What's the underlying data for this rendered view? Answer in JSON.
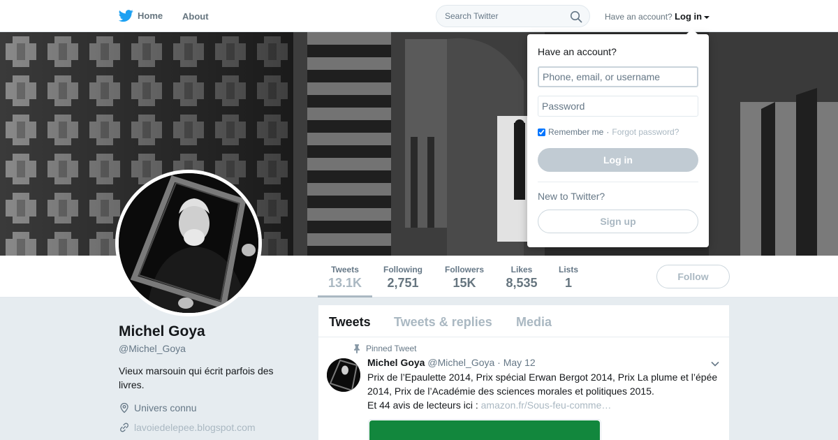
{
  "nav": {
    "home_label": "Home",
    "about_label": "About",
    "search_placeholder": "Search Twitter",
    "account_prefix": "Have an account?",
    "login_label": "Log in"
  },
  "profile": {
    "name": "Michel Goya",
    "handle": "@Michel_Goya",
    "bio": "Vieux marsouin qui écrit parfois des livres.",
    "location": "Univers connu",
    "url": "lavoiedelepee.blogspot.com"
  },
  "stats": [
    {
      "label": "Tweets",
      "value": "13.1K"
    },
    {
      "label": "Following",
      "value": "2,751"
    },
    {
      "label": "Followers",
      "value": "15K"
    },
    {
      "label": "Likes",
      "value": "8,535"
    },
    {
      "label": "Lists",
      "value": "1"
    }
  ],
  "follow_label": "Follow",
  "timeline": {
    "tabs": [
      "Tweets",
      "Tweets & replies",
      "Media"
    ],
    "pinned_label": "Pinned Tweet",
    "tweet": {
      "name": "Michel Goya",
      "handle": "@Michel_Goya",
      "separator": "·",
      "date": "May 12",
      "text": "Prix de l’Epaulette 2014, Prix spécial Erwan Bergot 2014, Prix La plume et l’épée 2014, Prix de l’Académie des sciences morales et politiques 2015.",
      "text2": "Et 44 avis de lecteurs ici :",
      "link": "amazon.fr/Sous-feu-comme…"
    }
  },
  "login_dropdown": {
    "title": "Have an account?",
    "username_placeholder": "Phone, email, or username",
    "password_placeholder": "Password",
    "remember_label": "Remember me",
    "separator": "·",
    "forgot_label": "Forgot password?",
    "login_button": "Log in",
    "new_label": "New to Twitter?",
    "signup_button": "Sign up"
  },
  "colors": {
    "brand_blue": "#1da1f2",
    "muted": "#aab8c2",
    "card_green": "#12873d"
  }
}
